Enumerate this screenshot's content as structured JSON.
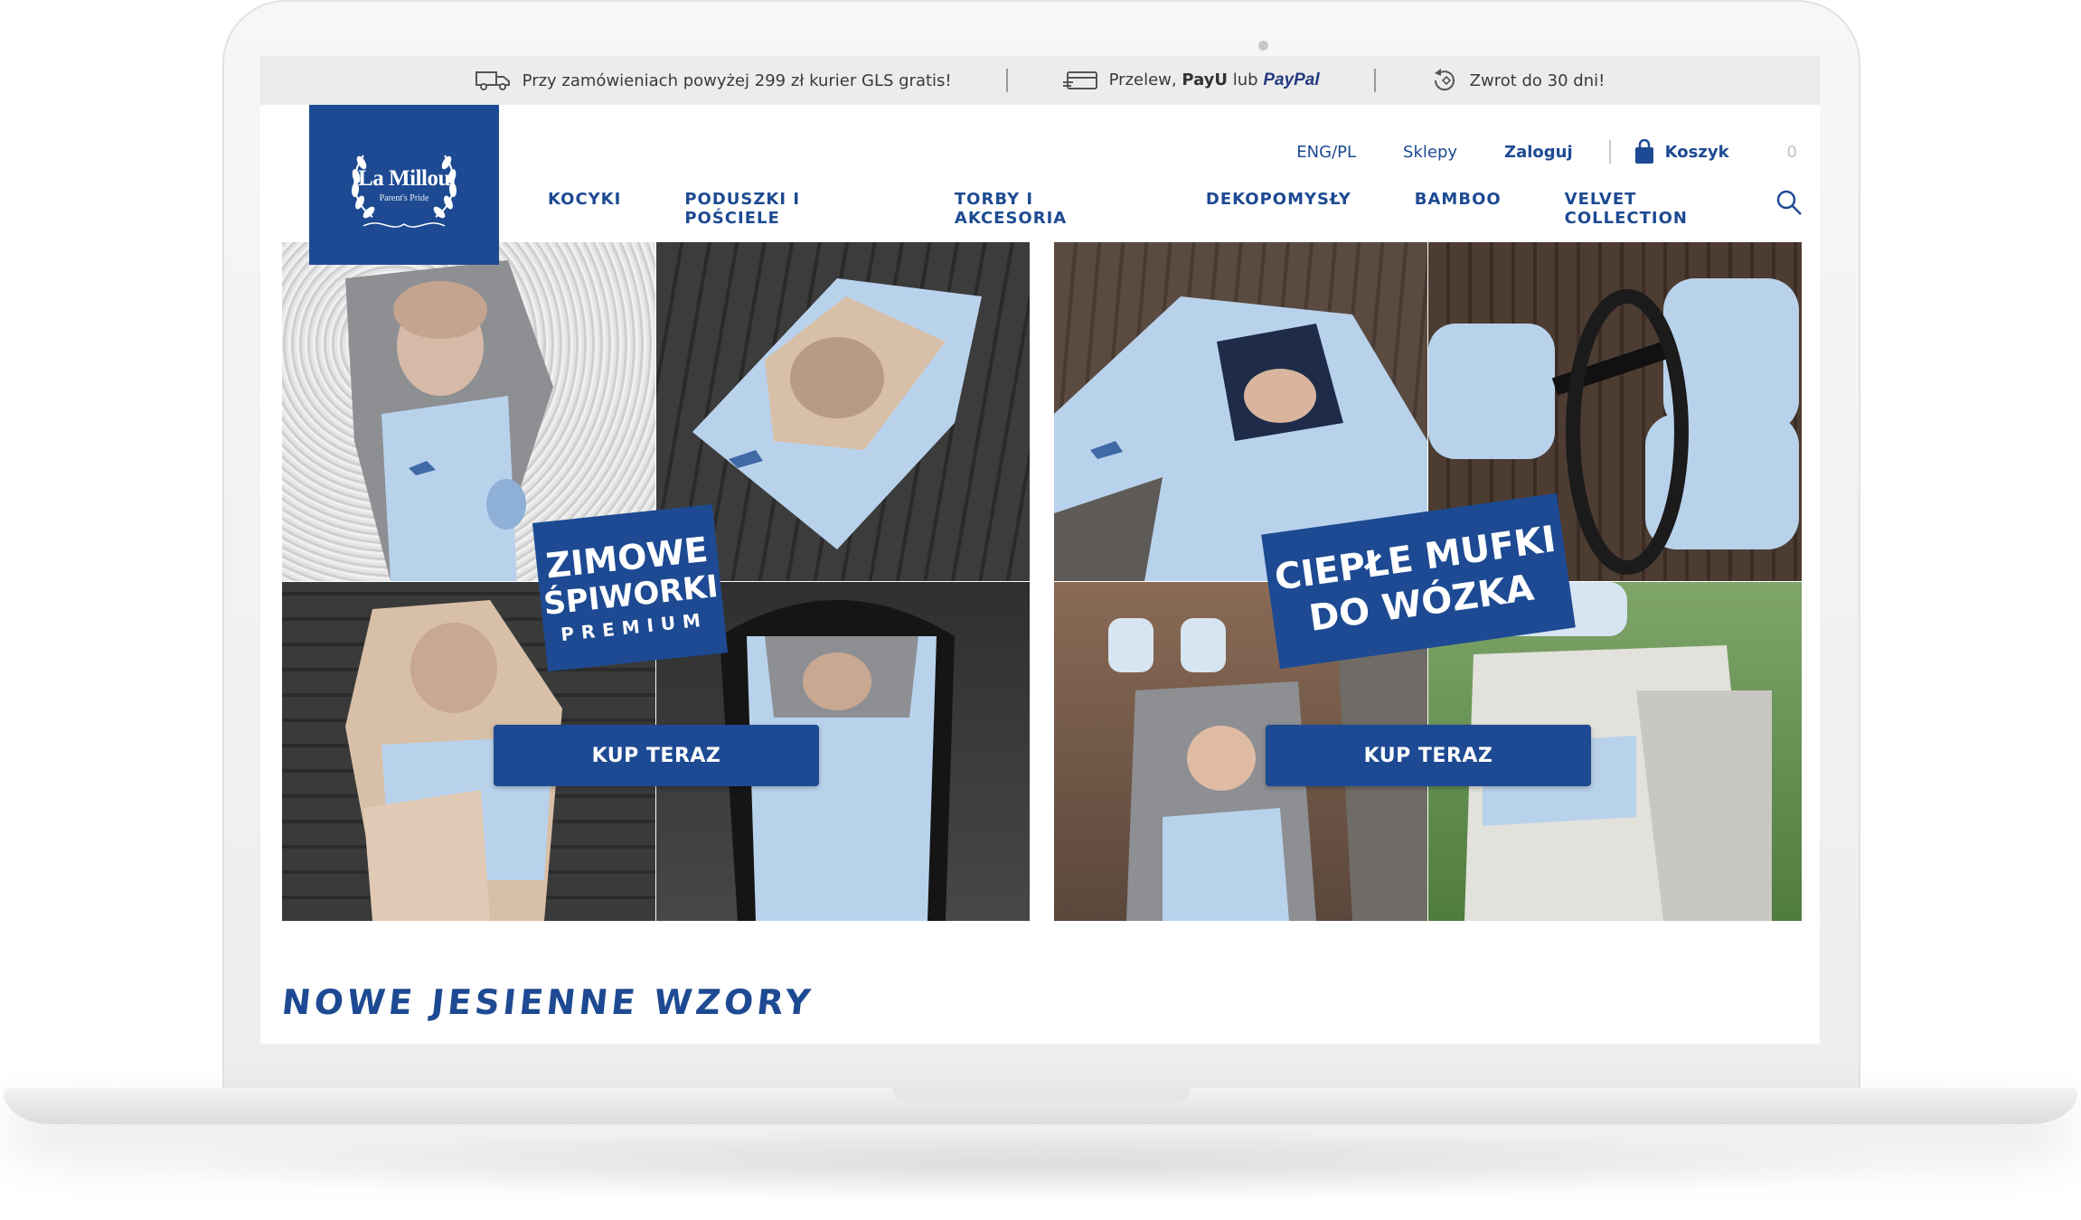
{
  "topbar": {
    "shipping": "Przy zamówieniach powyżej 299 zł kurier GLS gratis!",
    "payment_prefix": "Przelew,",
    "payment_payu": "PayU",
    "payment_mid": "lub",
    "payment_paypal": "PayPal",
    "returns": "Zwrot do 30 dni!"
  },
  "logo": {
    "name": "La Millou",
    "tagline": "Parent's Pride"
  },
  "util": {
    "lang": "ENG/PL",
    "shops": "Sklepy",
    "login": "Zaloguj",
    "cart": "Koszyk",
    "cart_count": "0"
  },
  "nav": [
    "KOCYKI",
    "PODUSZKI I POŚCIELE",
    "TORBY I AKCESORIA",
    "DEKOPOMYSŁY",
    "BAMBOO",
    "VELVET COLLECTION"
  ],
  "banners": [
    {
      "line1": "ZIMOWE",
      "line2": "ŚPIWORKI",
      "line3": "PREMIUM",
      "cta": "KUP TERAZ"
    },
    {
      "line1": "CIEPŁE MUFKI",
      "line2": "DO WÓZKA",
      "line3": "",
      "cta": "KUP TERAZ"
    }
  ],
  "section": {
    "title": "NOWE JESIENNE WZORY"
  },
  "colors": {
    "brand": "#1d4a92",
    "topbar": "#ececed",
    "fabric_blue": "#b9d2ec",
    "minky_grey": "#8d8f93",
    "minky_beige": "#d8bfa7"
  }
}
